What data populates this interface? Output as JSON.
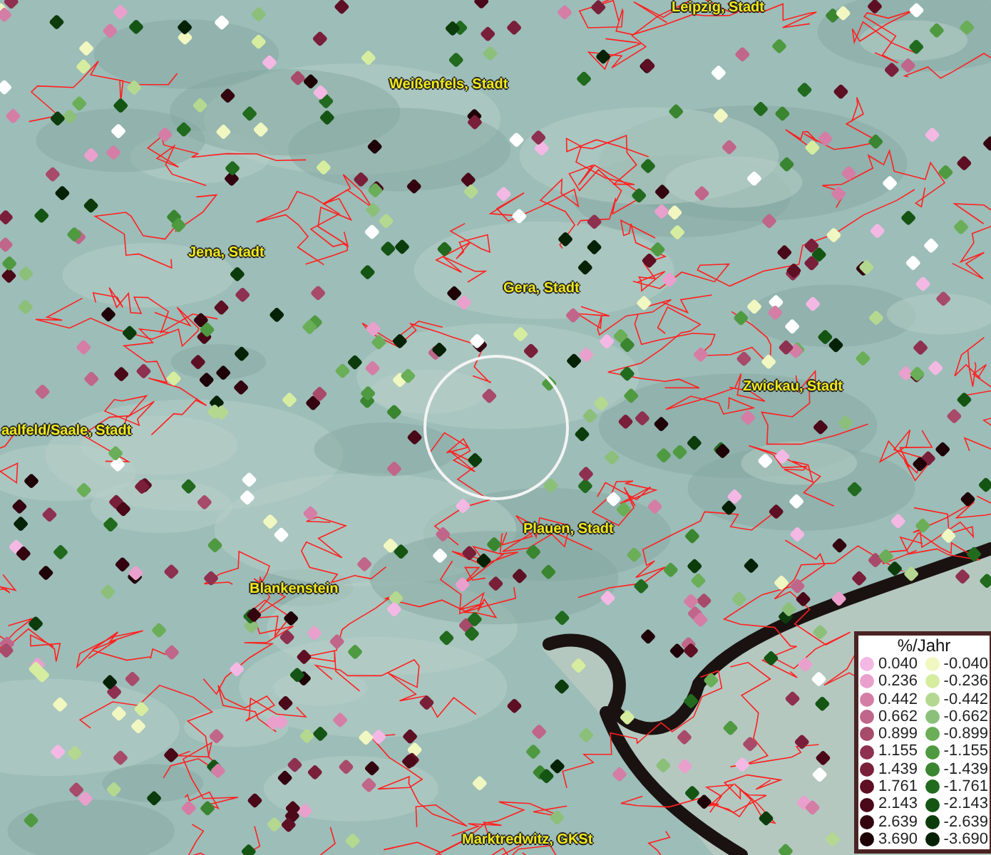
{
  "map": {
    "places": [
      {
        "label": "Leipzig, Stadt"
      },
      {
        "label": "Weißenfels, Stadt"
      },
      {
        "label": "Jena, Stadt"
      },
      {
        "label": "Gera, Stadt"
      },
      {
        "label": "Zwickau, Stadt"
      },
      {
        "label": "aalfeld/Saale, Stadt"
      },
      {
        "label": "Plauen, Stadt"
      },
      {
        "label": "Blankenstein"
      },
      {
        "label": "Marktredwitz, GKSt"
      }
    ]
  },
  "legend": {
    "title": "%/Jahr",
    "rows": [
      [
        {
          "value": "0.040",
          "color": "#f4b8e4"
        },
        {
          "value": "-0.040",
          "color": "#f0f7c0"
        }
      ],
      [
        {
          "value": "0.236",
          "color": "#e9a0cc"
        },
        {
          "value": "-0.236",
          "color": "#d6eda0"
        }
      ],
      [
        {
          "value": "0.442",
          "color": "#d47ea6"
        },
        {
          "value": "-0.442",
          "color": "#b4d890"
        }
      ],
      [
        {
          "value": "0.662",
          "color": "#c0668a"
        },
        {
          "value": "-0.662",
          "color": "#8cc07a"
        }
      ],
      [
        {
          "value": "0.899",
          "color": "#a84a6a"
        },
        {
          "value": "-0.899",
          "color": "#6aae58"
        }
      ],
      [
        {
          "value": "1.155",
          "color": "#8e3050"
        },
        {
          "value": "-1.155",
          "color": "#4f9a40"
        }
      ],
      [
        {
          "value": "1.439",
          "color": "#7a1f3a"
        },
        {
          "value": "-1.439",
          "color": "#3a8530"
        }
      ],
      [
        {
          "value": "1.761",
          "color": "#5e0f24"
        },
        {
          "value": "-1.761",
          "color": "#216a1e"
        }
      ],
      [
        {
          "value": "2.143",
          "color": "#4a0818"
        },
        {
          "value": "-2.143",
          "color": "#145514"
        }
      ],
      [
        {
          "value": "2.639",
          "color": "#330410"
        },
        {
          "value": "-2.639",
          "color": "#0c3c0c"
        }
      ],
      [
        {
          "value": "3.690",
          "color": "#1e0208"
        },
        {
          "value": "-3.690",
          "color": "#062206"
        }
      ]
    ]
  }
}
